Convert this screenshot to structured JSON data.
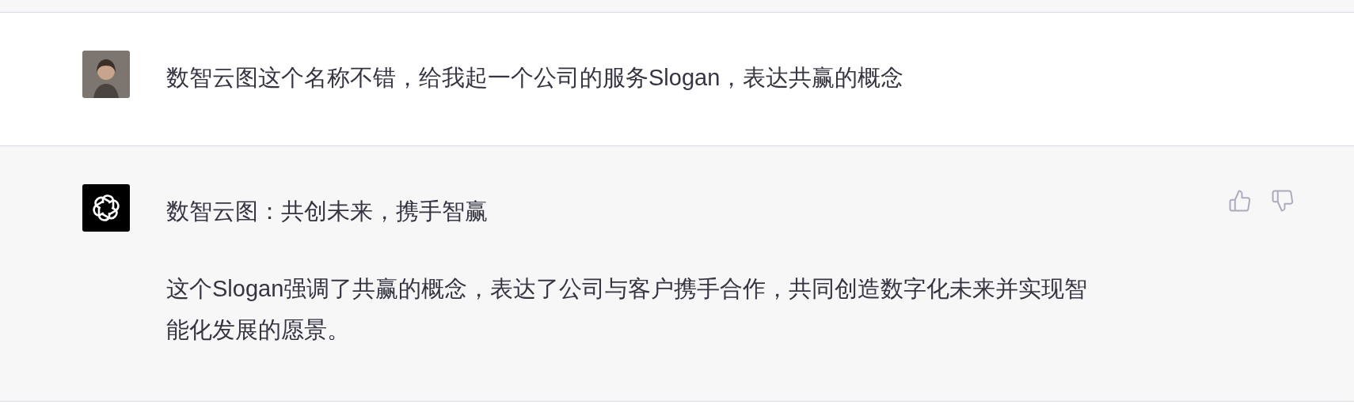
{
  "messages": [
    {
      "kind": "user",
      "paragraphs": [
        "数智云图这个名称不错，给我起一个公司的服务Slogan，表达共赢的概念"
      ]
    },
    {
      "kind": "assistant",
      "paragraphs": [
        "数智云图：共创未来，携手智赢",
        "这个Slogan强调了共赢的概念，表达了公司与客户携手合作，共同创造数字化未来并实现智能化发展的愿景。"
      ]
    }
  ]
}
